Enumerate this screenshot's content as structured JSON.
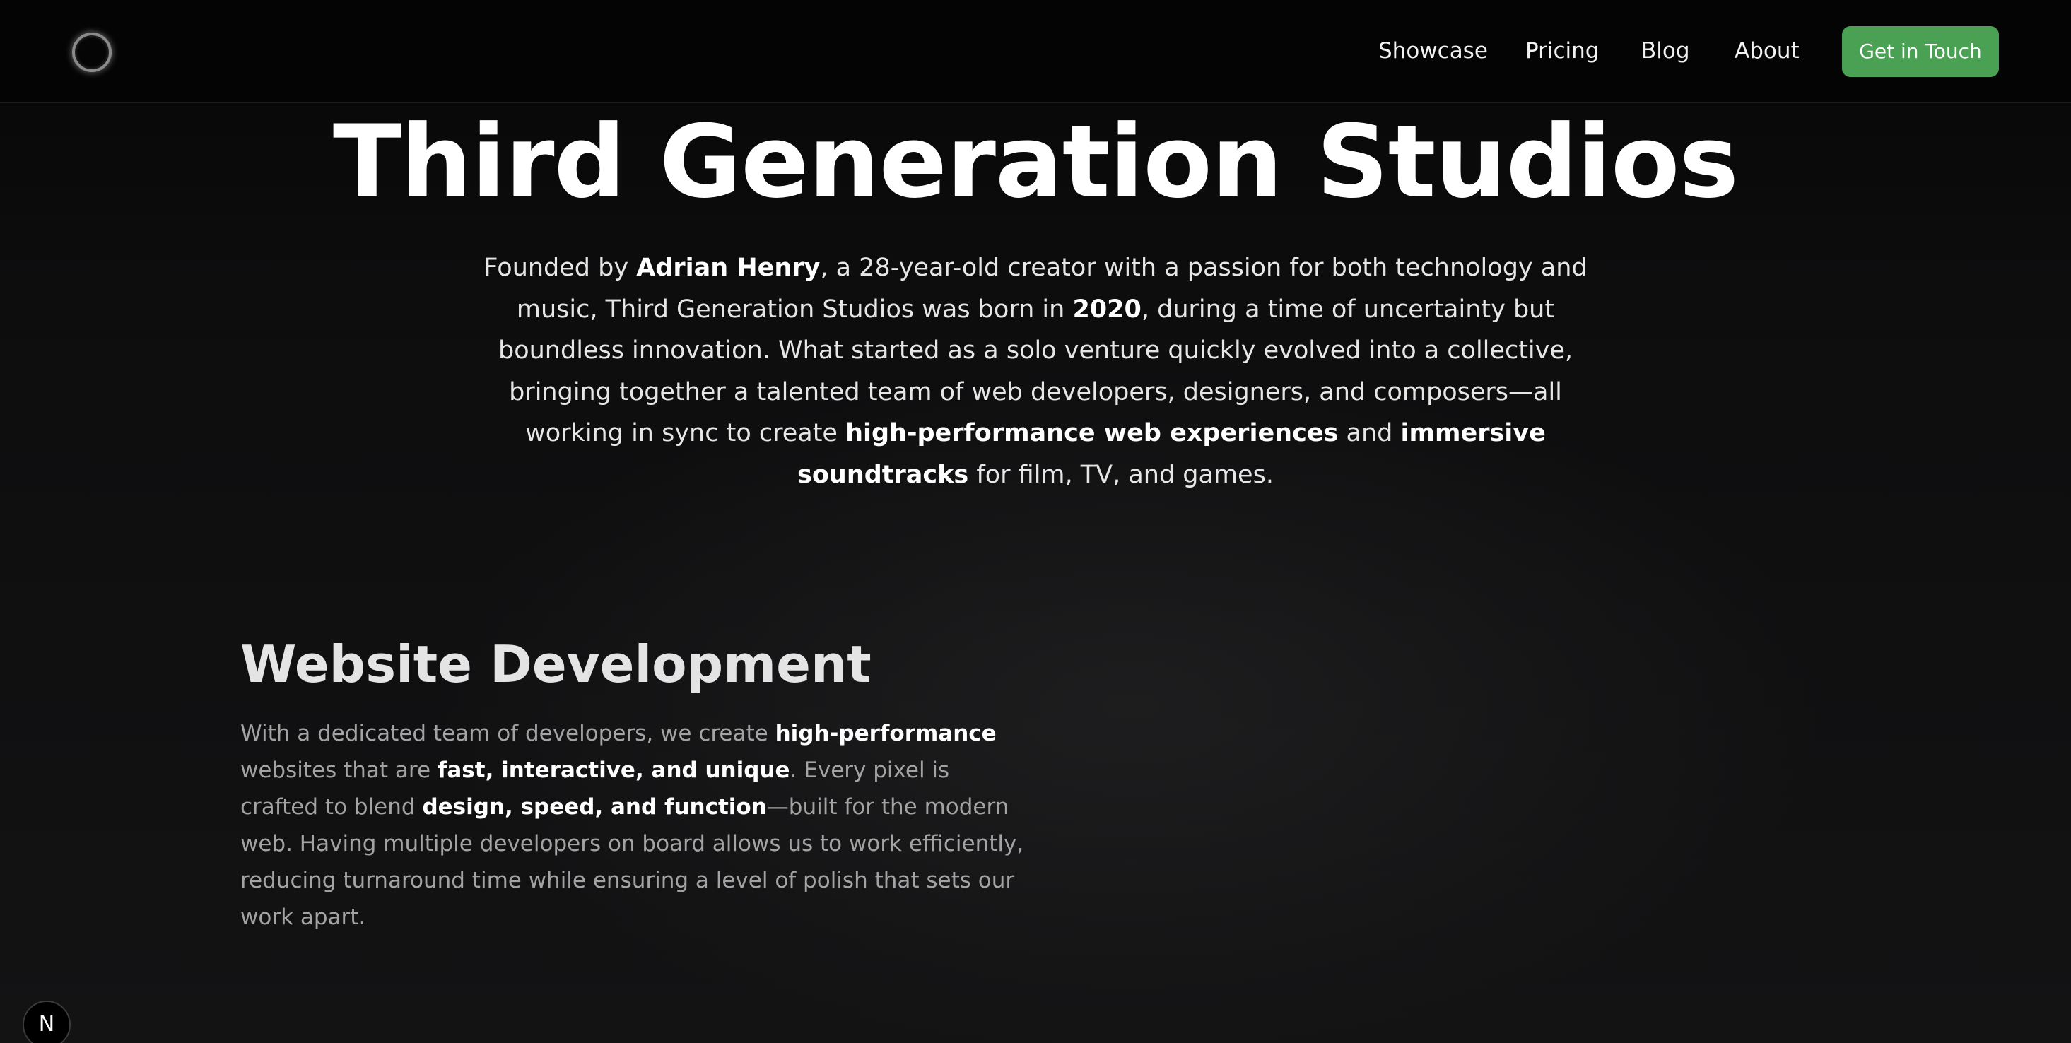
{
  "nav": {
    "logo_icon": "ring-logo-icon",
    "links": [
      "Showcase",
      "Pricing",
      "Blog",
      "About"
    ],
    "cta_label": "Get in Touch",
    "cta_color": "#4aa153"
  },
  "hero": {
    "title": "Third Generation Studios",
    "intro": [
      {
        "t": "Founded by ",
        "b": false
      },
      {
        "t": "Adrian Henry",
        "b": true
      },
      {
        "t": ", a 28-year-old creator with a passion for both technology and music, Third Generation Studios was born in ",
        "b": false
      },
      {
        "t": "2020",
        "b": true
      },
      {
        "t": ", during a time of uncertainty but boundless innovation. What started as a solo venture quickly evolved into a collective, bringing together a talented team of web developers, designers, and composers—all working in sync to create ",
        "b": false
      },
      {
        "t": "high-performance web experiences",
        "b": true
      },
      {
        "t": " and ",
        "b": false
      },
      {
        "t": "immersive soundtracks",
        "b": true
      },
      {
        "t": " for film, TV, and games.",
        "b": false
      }
    ]
  },
  "section": {
    "title": "Website Development",
    "body": [
      {
        "t": "With a dedicated team of developers, we create ",
        "b": false
      },
      {
        "t": "high-performance",
        "b": true
      },
      {
        "t": " websites that are ",
        "b": false
      },
      {
        "t": "fast, interactive, and unique",
        "b": true
      },
      {
        "t": ". Every pixel is crafted to blend ",
        "b": false
      },
      {
        "t": "design, speed, and function",
        "b": true
      },
      {
        "t": "—built for the modern web. Having multiple developers on board allows us to work efficiently, reducing turnaround time while ensuring a level of polish that sets our work apart.",
        "b": false
      }
    ]
  },
  "dev_badge": {
    "label": "N",
    "icon": "nextjs-icon"
  }
}
